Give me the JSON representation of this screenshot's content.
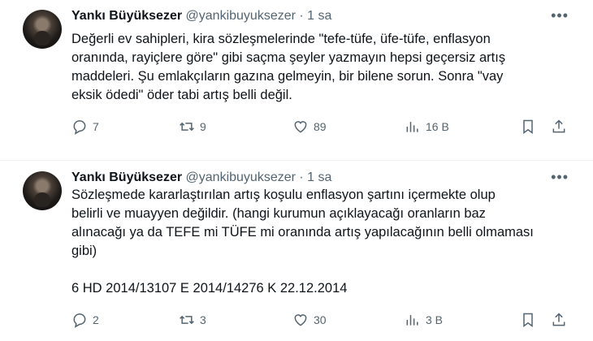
{
  "tweets": [
    {
      "name": "Yankı Büyüksezer",
      "handle": "@yankibuyuksezer · 1 sa",
      "more": "•••",
      "text": "Değerli ev sahipleri, kira sözleşmelerinde \"tefe-tüfe, üfe-tüfe, enflasyon\noranında, rayiçlere göre\" gibi saçma şeyler yazmayın hepsi geçersiz artış\nmaddeleri. Şu emlakçıların gazına gelmeyin, bir bilene sorun. Sonra \"vay\neksik ödedi\" öder tabi artış belli değil.",
      "replies": "7",
      "retweets": "9",
      "likes": "89",
      "views": "16 B"
    },
    {
      "name": "Yankı Büyüksezer",
      "handle": "@yankibuyuksezer · 1 sa",
      "more": "•••",
      "text": "Sözleşmede kararlaştırılan artış koşulu enflasyon şartını içermekte olup\nbelirli ve muayyen değildir. (hangi kurumun açıklayacağı oranların baz\nalınacağı ya da TEFE mi TÜFE mi oranında artış yapılacağının belli olmaması\ngibi)\n\n6 HD 2014/13107 E 2014/14276 K 22.12.2014",
      "replies": "2",
      "retweets": "3",
      "likes": "30",
      "views": "3 B"
    }
  ],
  "icons": {
    "reply": "speech-bubble-icon",
    "retweet": "retweet-arrows-icon",
    "like": "heart-icon",
    "views": "bar-chart-icon",
    "bookmark": "bookmark-icon",
    "share": "share-upload-icon"
  }
}
